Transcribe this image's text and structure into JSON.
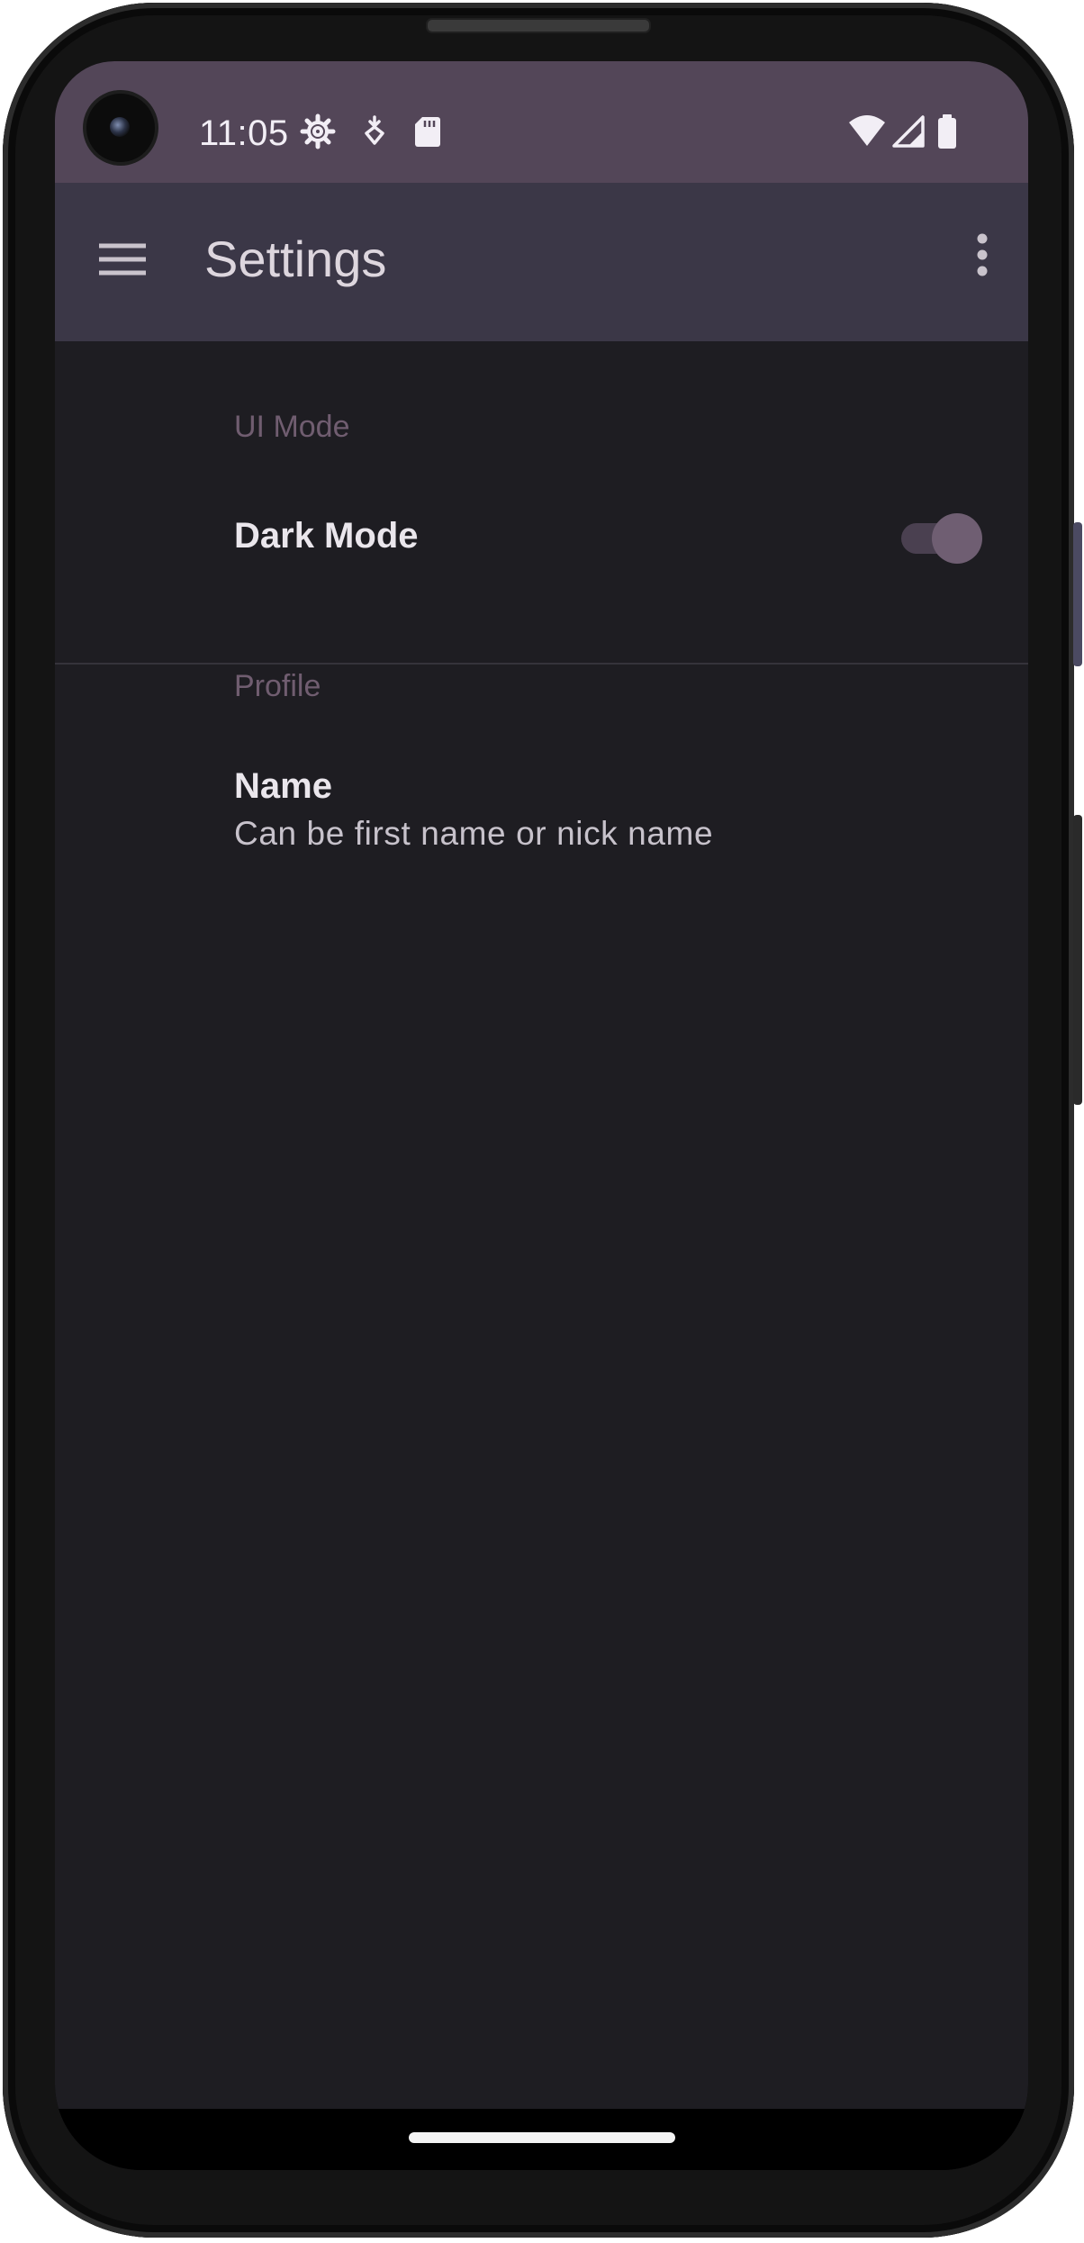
{
  "status_bar": {
    "time": "11:05",
    "icons": [
      "gear-icon",
      "download-shield-icon",
      "sd-card-icon",
      "wifi-icon",
      "cell-signal-icon",
      "battery-icon"
    ],
    "color": "#534658"
  },
  "app_bar": {
    "title": "Settings",
    "menu_icon": "hamburger-menu-icon",
    "overflow_icon": "more-vert-icon",
    "color": "#3b3747"
  },
  "sections": [
    {
      "category": "UI Mode",
      "items": [
        {
          "title": "Dark Mode",
          "type": "switch",
          "checked": true
        }
      ]
    },
    {
      "category": "Profile",
      "items": [
        {
          "title": "Name",
          "summary": "Can be first name or nick name"
        }
      ]
    }
  ],
  "colors": {
    "background": "#1e1d22",
    "category_text": "#705d70",
    "switch_thumb": "#6f5e72"
  }
}
